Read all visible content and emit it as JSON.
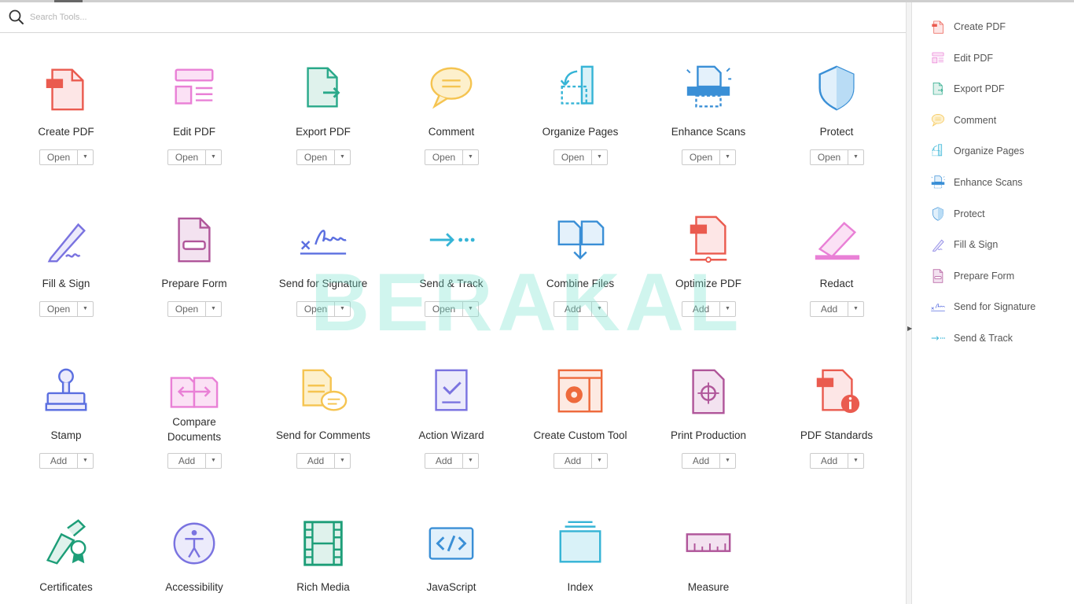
{
  "search": {
    "placeholder": "Search Tools..."
  },
  "watermark": "BERAKAL",
  "tools": [
    {
      "label": "Create PDF",
      "button": "Open",
      "icon": "create-pdf-icon"
    },
    {
      "label": "Edit PDF",
      "button": "Open",
      "icon": "edit-pdf-icon"
    },
    {
      "label": "Export PDF",
      "button": "Open",
      "icon": "export-pdf-icon"
    },
    {
      "label": "Comment",
      "button": "Open",
      "icon": "comment-icon"
    },
    {
      "label": "Organize Pages",
      "button": "Open",
      "icon": "organize-pages-icon"
    },
    {
      "label": "Enhance Scans",
      "button": "Open",
      "icon": "enhance-scans-icon"
    },
    {
      "label": "Protect",
      "button": "Open",
      "icon": "protect-shield-icon"
    },
    {
      "label": "Fill & Sign",
      "button": "Open",
      "icon": "fill-sign-pen-icon"
    },
    {
      "label": "Prepare Form",
      "button": "Open",
      "icon": "prepare-form-icon"
    },
    {
      "label": "Send for Signature",
      "button": "Open",
      "icon": "send-for-signature-icon"
    },
    {
      "label": "Send & Track",
      "button": "Open",
      "icon": "send-track-arrow-icon"
    },
    {
      "label": "Combine Files",
      "button": "Add",
      "icon": "combine-files-icon"
    },
    {
      "label": "Optimize PDF",
      "button": "Add",
      "icon": "optimize-pdf-icon"
    },
    {
      "label": "Redact",
      "button": "Add",
      "icon": "redact-marker-icon"
    },
    {
      "label": "Stamp",
      "button": "Add",
      "icon": "stamp-icon"
    },
    {
      "label": "Compare\nDocuments",
      "button": "Add",
      "icon": "compare-documents-icon"
    },
    {
      "label": "Send for Comments",
      "button": "Add",
      "icon": "send-for-comments-icon"
    },
    {
      "label": "Action Wizard",
      "button": "Add",
      "icon": "action-wizard-icon"
    },
    {
      "label": "Create Custom Tool",
      "button": "Add",
      "icon": "custom-tool-gear-icon"
    },
    {
      "label": "Print Production",
      "button": "Add",
      "icon": "print-production-icon"
    },
    {
      "label": "PDF Standards",
      "button": "Add",
      "icon": "pdf-standards-icon"
    },
    {
      "label": "Certificates",
      "button": "",
      "icon": "certificates-icon"
    },
    {
      "label": "Accessibility",
      "button": "",
      "icon": "accessibility-icon"
    },
    {
      "label": "Rich Media",
      "button": "",
      "icon": "rich-media-film-icon"
    },
    {
      "label": "JavaScript",
      "button": "",
      "icon": "javascript-code-icon"
    },
    {
      "label": "Index",
      "button": "",
      "icon": "index-stack-icon"
    },
    {
      "label": "Measure",
      "button": "",
      "icon": "measure-ruler-icon"
    }
  ],
  "sidebar": {
    "items": [
      {
        "label": "Create PDF",
        "icon": "create-pdf-icon"
      },
      {
        "label": "Edit PDF",
        "icon": "edit-pdf-icon"
      },
      {
        "label": "Export PDF",
        "icon": "export-pdf-icon"
      },
      {
        "label": "Comment",
        "icon": "comment-icon"
      },
      {
        "label": "Organize Pages",
        "icon": "organize-pages-icon"
      },
      {
        "label": "Enhance Scans",
        "icon": "enhance-scans-icon"
      },
      {
        "label": "Protect",
        "icon": "protect-shield-icon"
      },
      {
        "label": "Fill & Sign",
        "icon": "fill-sign-pen-icon"
      },
      {
        "label": "Prepare Form",
        "icon": "prepare-form-icon"
      },
      {
        "label": "Send for Signature",
        "icon": "send-for-signature-icon"
      },
      {
        "label": "Send & Track",
        "icon": "send-track-arrow-icon"
      }
    ]
  },
  "colors": {
    "red": "#ea5b4f",
    "pink": "#e980d6",
    "teal": "#2aa98a",
    "yellow": "#f5c451",
    "cyan": "#36b4d6",
    "blue": "#3a8fd6",
    "purple": "#7a73e0",
    "magenta": "#b0569a",
    "green": "#1d9e78",
    "orange": "#ee6a3c"
  }
}
